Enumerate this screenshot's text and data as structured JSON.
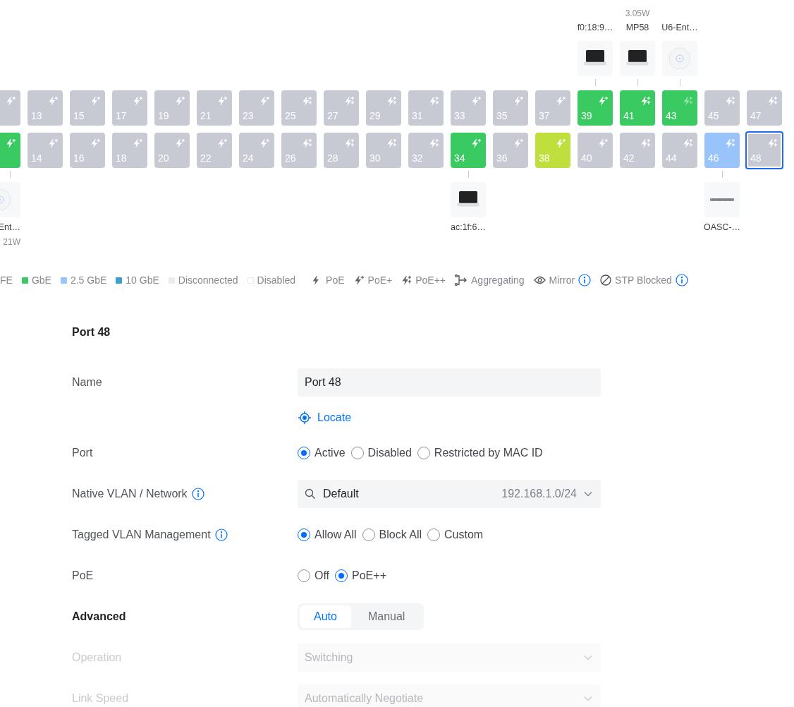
{
  "ports": {
    "columns": [
      {
        "cut": true,
        "top": {
          "kind": "poeplus",
          "color": "#c8cad3",
          "poe_active": true,
          "selected": false
        },
        "bottom": {
          "kind": "poeplus",
          "color": "#39ca62",
          "poe_active": true,
          "selected": false
        },
        "bottom_device": {
          "kind": "accesspoint",
          "label": "Ent…",
          "power": "21W"
        }
      },
      {
        "top": {
          "number": "13",
          "kind": "poeplus",
          "color": "#c8cad3",
          "poe_active": true,
          "selected": false
        },
        "bottom": {
          "number": "14",
          "kind": "poeplus",
          "color": "#c8cad3",
          "poe_active": true,
          "selected": false
        }
      },
      {
        "top": {
          "number": "15",
          "kind": "poeplus",
          "color": "#c8cad3",
          "poe_active": true,
          "selected": false
        },
        "bottom": {
          "number": "16",
          "kind": "poeplus",
          "color": "#c8cad3",
          "poe_active": true,
          "selected": false
        }
      },
      {
        "top": {
          "number": "17",
          "kind": "poeplus",
          "color": "#c8cad3",
          "poe_active": true,
          "selected": false
        },
        "bottom": {
          "number": "18",
          "kind": "poeplus",
          "color": "#c8cad3",
          "poe_active": true,
          "selected": false
        }
      },
      {
        "top": {
          "number": "19",
          "kind": "poeplus",
          "color": "#c8cad3",
          "poe_active": true,
          "selected": false
        },
        "bottom": {
          "number": "20",
          "kind": "poeplus",
          "color": "#c8cad3",
          "poe_active": true,
          "selected": false
        }
      },
      {
        "top": {
          "number": "21",
          "kind": "poeplus",
          "color": "#c8cad3",
          "poe_active": true,
          "selected": false
        },
        "bottom": {
          "number": "22",
          "kind": "poeplus",
          "color": "#c8cad3",
          "poe_active": true,
          "selected": false
        }
      },
      {
        "top": {
          "number": "23",
          "kind": "poeplus",
          "color": "#c8cad3",
          "poe_active": true,
          "selected": false
        },
        "bottom": {
          "number": "24",
          "kind": "poeplus",
          "color": "#c8cad3",
          "poe_active": true,
          "selected": false
        }
      },
      {
        "top": {
          "number": "25",
          "kind": "poeplusplus",
          "color": "#c8cad3",
          "poe_active": true,
          "selected": false
        },
        "bottom": {
          "number": "26",
          "kind": "poeplusplus",
          "color": "#c8cad3",
          "poe_active": true,
          "selected": false
        }
      },
      {
        "top": {
          "number": "27",
          "kind": "poeplusplus",
          "color": "#c8cad3",
          "poe_active": true,
          "selected": false
        },
        "bottom": {
          "number": "28",
          "kind": "poeplusplus",
          "color": "#c8cad3",
          "poe_active": true,
          "selected": false
        }
      },
      {
        "top": {
          "number": "29",
          "kind": "poeplusplus",
          "color": "#c8cad3",
          "poe_active": true,
          "selected": false
        },
        "bottom": {
          "number": "30",
          "kind": "poeplusplus",
          "color": "#c8cad3",
          "poe_active": true,
          "selected": false
        }
      },
      {
        "top": {
          "number": "31",
          "kind": "poeplusplus",
          "color": "#c8cad3",
          "poe_active": true,
          "selected": false
        },
        "bottom": {
          "number": "32",
          "kind": "poeplusplus",
          "color": "#c8cad3",
          "poe_active": true,
          "selected": false
        }
      },
      {
        "top": {
          "number": "33",
          "kind": "poeplus",
          "color": "#c8cad3",
          "poe_active": true,
          "selected": false
        },
        "bottom": {
          "number": "34",
          "kind": "poeplus",
          "color": "#39ca62",
          "poe_active": true,
          "selected": false
        },
        "bottom_device": {
          "kind": "laptop",
          "label": "ac:1f:6…"
        }
      },
      {
        "top": {
          "number": "35",
          "kind": "poeplus",
          "color": "#c8cad3",
          "poe_active": true,
          "selected": false
        },
        "bottom": {
          "number": "36",
          "kind": "poeplus",
          "color": "#c8cad3",
          "poe_active": true,
          "selected": false
        }
      },
      {
        "top": {
          "number": "37",
          "kind": "poeplus",
          "color": "#c8cad3",
          "poe_active": true,
          "selected": false
        },
        "bottom": {
          "number": "38",
          "kind": "poeplus",
          "color": "#bfe03c",
          "poe_active": true,
          "selected": false
        }
      },
      {
        "top_device": {
          "kind": "laptop",
          "label": "f0:18:9…"
        },
        "top": {
          "number": "39",
          "kind": "poeplus",
          "color": "#39ca62",
          "poe_active": true,
          "selected": false
        },
        "bottom": {
          "number": "40",
          "kind": "poeplus",
          "color": "#c8cad3",
          "poe_active": true,
          "selected": false
        }
      },
      {
        "top_device": {
          "kind": "laptop",
          "label": "MP58",
          "power": "3.05W"
        },
        "top": {
          "number": "41",
          "kind": "poeplusplus",
          "color": "#39ca62",
          "poe_active": true,
          "selected": false
        },
        "bottom": {
          "number": "42",
          "kind": "poeplusplus",
          "color": "#c8cad3",
          "poe_active": true,
          "selected": false
        }
      },
      {
        "top_device": {
          "kind": "accesspoint",
          "label": "U6-Ent…"
        },
        "top": {
          "number": "43",
          "kind": "poeplusplus",
          "color": "#39ca62",
          "poe_active": false,
          "selected": false
        },
        "bottom": {
          "number": "44",
          "kind": "poeplusplus",
          "color": "#c8cad3",
          "poe_active": true,
          "selected": false
        }
      },
      {
        "top": {
          "number": "45",
          "kind": "poeplusplus",
          "color": "#c8cad3",
          "poe_active": true,
          "selected": false
        },
        "bottom": {
          "number": "46",
          "kind": "poeplusplus",
          "color": "#98c3fb",
          "poe_active": true,
          "selected": false
        },
        "bottom_device": {
          "kind": "switch",
          "label": "OASC-…"
        }
      },
      {
        "top": {
          "number": "47",
          "kind": "poeplusplus",
          "color": "#c8cad3",
          "poe_active": true,
          "selected": false
        },
        "bottom": {
          "number": "48",
          "kind": "poeplusplus",
          "color": "#c8cad3",
          "poe_active": true,
          "selected": true
        }
      }
    ]
  },
  "legend": [
    {
      "kind": "speed",
      "label": "FE"
    },
    {
      "kind": "speed",
      "label": "GbE",
      "color": "#39ca62"
    },
    {
      "kind": "speed",
      "label": "2.5 GbE",
      "color": "#98c3fb"
    },
    {
      "kind": "speed",
      "label": "10 GbE",
      "color": "#3b9fcf"
    },
    {
      "kind": "speed",
      "label": "Disconnected",
      "color": "#ebecee"
    },
    {
      "kind": "speed",
      "label": "Disabled",
      "color": "#ffffff"
    },
    {
      "kind": "poe",
      "label": "PoE"
    },
    {
      "kind": "poeplus",
      "label": "PoE+"
    },
    {
      "kind": "poeplusplus",
      "label": "PoE++"
    },
    {
      "kind": "aggregating",
      "label": "Aggregating"
    },
    {
      "kind": "mirror",
      "label": "Mirror",
      "info": true
    },
    {
      "kind": "stp",
      "label": "STP Blocked",
      "info": true
    }
  ],
  "form": {
    "title": "Port 48",
    "rows": [
      {
        "kind": "text",
        "label": "Name",
        "value": "Port 48"
      },
      {
        "kind": "link",
        "link": "Locate"
      },
      {
        "kind": "radio",
        "label": "Port",
        "options": [
          {
            "label": "Active",
            "selected": true
          },
          {
            "label": "Disabled",
            "selected": false
          },
          {
            "label": "Restricted by MAC ID",
            "selected": false
          }
        ]
      },
      {
        "kind": "select",
        "label": "Native VLAN / Network",
        "info": true,
        "search": true,
        "disabled": false,
        "value": "Default",
        "detail": "192.168.1.0/24"
      },
      {
        "kind": "radio",
        "label": "Tagged VLAN Management",
        "info": true,
        "options": [
          {
            "label": "Allow All",
            "selected": true
          },
          {
            "label": "Block All",
            "selected": false
          },
          {
            "label": "Custom",
            "selected": false
          }
        ]
      },
      {
        "kind": "radio",
        "label": "PoE",
        "options": [
          {
            "label": "Off",
            "selected": false
          },
          {
            "label": "PoE++",
            "selected": true
          }
        ]
      },
      {
        "kind": "segmented",
        "label": "Advanced",
        "options": [
          {
            "label": "Auto",
            "selected": true
          },
          {
            "label": "Manual",
            "selected": false
          }
        ]
      },
      {
        "kind": "select",
        "label": "Operation",
        "disabled": true,
        "value": "Switching"
      },
      {
        "kind": "select",
        "label": "Link Speed",
        "disabled": true,
        "value": "Automatically Negotiate"
      }
    ]
  }
}
